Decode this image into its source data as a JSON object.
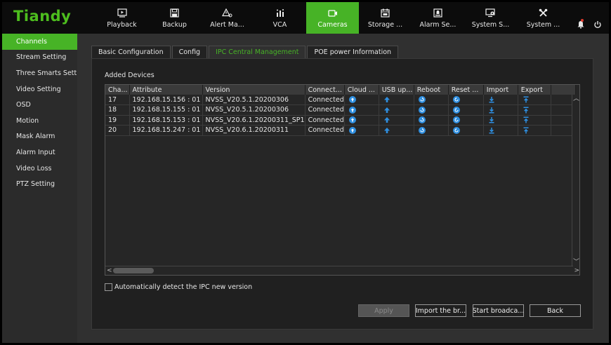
{
  "brand": {
    "logo": "Tiandy",
    "accent": "#47b326"
  },
  "nav": [
    {
      "label": "Playback",
      "icon": "playback-icon",
      "active": false
    },
    {
      "label": "Backup",
      "icon": "save-icon",
      "active": false
    },
    {
      "label": "Alert Ma...",
      "icon": "alert-icon",
      "active": false
    },
    {
      "label": "VCA",
      "icon": "vca-icon",
      "active": false
    },
    {
      "label": "Cameras",
      "icon": "camera-icon",
      "active": true
    },
    {
      "label": "Storage ...",
      "icon": "storage-icon",
      "active": false
    },
    {
      "label": "Alarm Se...",
      "icon": "alarm-settings-icon",
      "active": false
    },
    {
      "label": "System S...",
      "icon": "system-settings-icon",
      "active": false
    },
    {
      "label": "System ...",
      "icon": "tools-icon",
      "active": false
    }
  ],
  "sidebar": {
    "items": [
      {
        "label": "Channels",
        "active": true
      },
      {
        "label": "Stream Setting",
        "active": false
      },
      {
        "label": "Three Smarts Sett...",
        "active": false
      },
      {
        "label": "Video Setting",
        "active": false
      },
      {
        "label": "OSD",
        "active": false
      },
      {
        "label": "Motion",
        "active": false
      },
      {
        "label": "Mask Alarm",
        "active": false
      },
      {
        "label": "Alarm Input",
        "active": false
      },
      {
        "label": "Video Loss",
        "active": false
      },
      {
        "label": "PTZ Setting",
        "active": false
      }
    ]
  },
  "tabs": [
    {
      "label": "Basic Configuration",
      "active": false
    },
    {
      "label": "Config",
      "active": false
    },
    {
      "label": "IPC Central Management",
      "active": true
    },
    {
      "label": "POE power Information",
      "active": false
    }
  ],
  "section": {
    "title": "Added Devices"
  },
  "table": {
    "columns": [
      "Cha...",
      "Attribute",
      "Version",
      "Connect...",
      "Cloud ...",
      "USB up...",
      "Reboot",
      "Reset ...",
      "Import",
      "Export"
    ],
    "rows": [
      {
        "channel": "17",
        "attribute": "192.168.15.156 : 01",
        "version": "NVSS_V20.5.1.20200306",
        "status": "Connected"
      },
      {
        "channel": "18",
        "attribute": "192.168.15.155 : 01",
        "version": "NVSS_V20.5.1.20200306",
        "status": "Connected"
      },
      {
        "channel": "19",
        "attribute": "192.168.15.153 : 01",
        "version": "NVSS_V20.6.1.20200311_SP1",
        "status": "Connected"
      },
      {
        "channel": "20",
        "attribute": "192.168.15.247 : 01",
        "version": "NVSS_V20.6.1.20200311",
        "status": "Connected"
      }
    ],
    "action_icons": [
      "cloud-upgrade-icon",
      "usb-upgrade-icon",
      "reboot-icon",
      "reset-icon",
      "import-icon",
      "export-icon"
    ],
    "icon_color": "#2f8fe0"
  },
  "auto_detect": {
    "label": "Automatically detect the IPC new version",
    "checked": false
  },
  "buttons": {
    "apply": "Apply",
    "import": "Import the br...",
    "broadcast": "Start broadca...",
    "back": "Back"
  }
}
